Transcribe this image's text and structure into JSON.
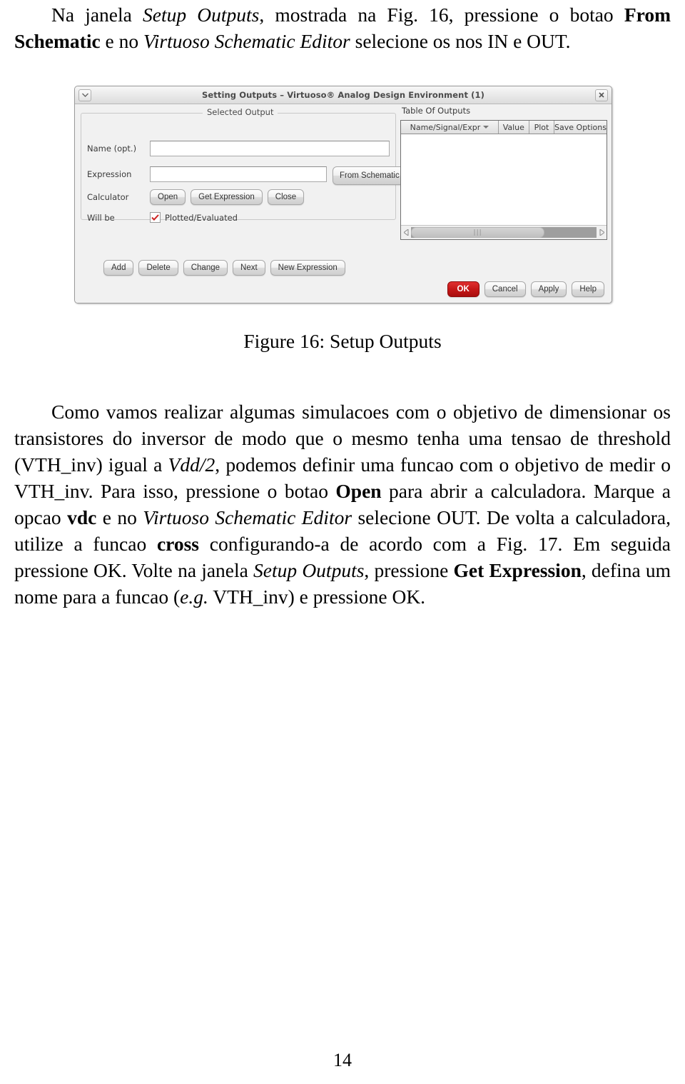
{
  "document": {
    "page_number": "14",
    "intro_paragraph": {
      "segments": [
        {
          "text": "Na janela ",
          "style": "normal"
        },
        {
          "text": "Setup Outputs",
          "style": "italic"
        },
        {
          "text": ", mostrada na Fig. 16, pressione o botao ",
          "style": "normal"
        },
        {
          "text": "From Schematic",
          "style": "bold"
        },
        {
          "text": " e no ",
          "style": "normal"
        },
        {
          "text": "Virtuoso Schematic Editor",
          "style": "italic"
        },
        {
          "text": " selecione os nos IN e OUT.",
          "style": "normal"
        }
      ]
    },
    "figure_caption": "Figure 16: Setup Outputs",
    "body_paragraph": {
      "segments": [
        {
          "text": "Como vamos realizar algumas simulacoes com o objetivo de dimensionar os transistores do inversor de modo que o mesmo tenha uma tensao de threshold (VTH_inv) igual a ",
          "style": "normal"
        },
        {
          "text": "Vdd/2",
          "style": "math"
        },
        {
          "text": ", podemos definir uma funcao com o objetivo de medir o VTH_inv. Para isso, pressione o botao ",
          "style": "normal"
        },
        {
          "text": "Open",
          "style": "bold"
        },
        {
          "text": " para abrir a calculadora. Marque a opcao ",
          "style": "normal"
        },
        {
          "text": "vdc",
          "style": "bold"
        },
        {
          "text": " e no ",
          "style": "normal"
        },
        {
          "text": "Virtuoso Schematic Editor",
          "style": "italic"
        },
        {
          "text": " selecione OUT. De volta a calculadora, utilize a funcao ",
          "style": "normal"
        },
        {
          "text": "cross",
          "style": "bold"
        },
        {
          "text": " configurando-a de acordo com a Fig. 17. Em seguida pressione OK. Volte na janela ",
          "style": "normal"
        },
        {
          "text": "Setup Outputs",
          "style": "italic"
        },
        {
          "text": ", pressione ",
          "style": "normal"
        },
        {
          "text": "Get Expression",
          "style": "bold"
        },
        {
          "text": ", defina um nome para a funcao (",
          "style": "normal"
        },
        {
          "text": "e.g.",
          "style": "italic"
        },
        {
          "text": " VTH_inv) e pressione OK.",
          "style": "normal"
        }
      ]
    }
  },
  "figure": {
    "window": {
      "title": "Setting Outputs – Virtuoso® Analog Design Environment (1)",
      "menu_icon": "chevron-down-icon",
      "close_icon": "close-icon"
    },
    "selected_output": {
      "group_title": "Selected Output",
      "name_label": "Name (opt.)",
      "name_value": "",
      "expression_label": "Expression",
      "expression_value": "",
      "from_schematic_label": "From Schematic",
      "calculator_label": "Calculator",
      "calculator_buttons": [
        "Open",
        "Get Expression",
        "Close"
      ],
      "will_be_label": "Will be",
      "checkbox_label": "Plotted/Evaluated",
      "checkbox_checked": "true",
      "checkbox_icon": "checkmark-icon",
      "checkbox_color": "#cc2222"
    },
    "action_buttons": [
      "Add",
      "Delete",
      "Change",
      "Next",
      "New Expression"
    ],
    "table_of_outputs": {
      "title": "Table Of Outputs",
      "columns": [
        "Name/Signal/Expr",
        "Value",
        "Plot",
        "Save Options"
      ],
      "sort_indicator_icon": "sort-descending-caret-icon",
      "rows": [],
      "hscroll": {
        "left_arrow_icon": "triangle-left-icon",
        "right_arrow_icon": "triangle-right-icon",
        "grip_icon": "grip-icon"
      }
    },
    "footer_buttons": [
      {
        "label": "OK",
        "accent": "#c41717"
      },
      {
        "label": "Cancel",
        "accent": ""
      },
      {
        "label": "Apply",
        "accent": ""
      },
      {
        "label": "Help",
        "accent": ""
      }
    ]
  }
}
